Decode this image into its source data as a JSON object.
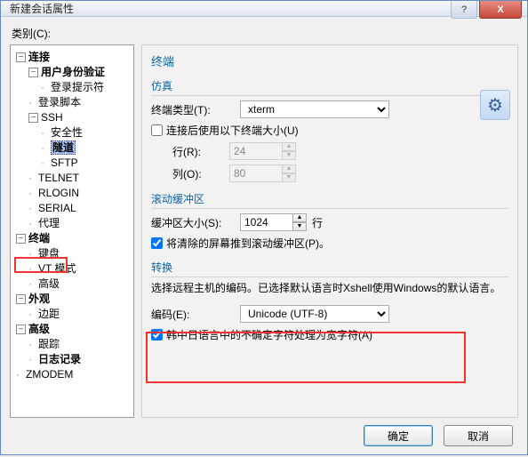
{
  "window": {
    "title": "新建会话属性"
  },
  "titlebar_icons": {
    "help": "?",
    "close": "X"
  },
  "category_label": "类别(C):",
  "tree": {
    "connection": "连接",
    "auth": "用户身份验证",
    "login_prompt": "登录提示符",
    "login_script": "登录脚本",
    "ssh": "SSH",
    "security": "安全性",
    "tunnel": "隧道",
    "sftp": "SFTP",
    "telnet": "TELNET",
    "rlogin": "RLOGIN",
    "serial": "SERIAL",
    "proxy": "代理",
    "terminal": "终端",
    "keyboard": "键盘",
    "vt": "VT 模式",
    "advanced_t": "高级",
    "appearance": "外观",
    "margin": "边距",
    "advanced": "高级",
    "trace": "跟踪",
    "log": "日志记录",
    "zmodem": "ZMODEM"
  },
  "content": {
    "section": "终端",
    "emulation": {
      "title": "仿真",
      "type_label": "终端类型(T):",
      "type_value": "xterm",
      "use_size_label": "连接后使用以下终端大小(U)",
      "use_size_checked": false,
      "rows_label": "行(R):",
      "rows_value": "24",
      "cols_label": "列(O):",
      "cols_value": "80"
    },
    "scrollback": {
      "title": "滚动缓冲区",
      "size_label": "缓冲区大小(S):",
      "size_value": "1024",
      "unit": "行",
      "clear_label": "将清除的屏幕推到滚动缓冲区(P)。",
      "clear_checked": true
    },
    "conversion": {
      "title": "转换",
      "desc": "选择远程主机的编码。已选择默认语言时Xshell使用Windows的默认语言。",
      "encoding_label": "编码(E):",
      "encoding_value": "Unicode (UTF-8)",
      "cjk_label": "韩中日语言中的不确定字符处理为宽字符(A)",
      "cjk_checked": true
    }
  },
  "buttons": {
    "ok": "确定",
    "cancel": "取消"
  },
  "icons": {
    "gear": "⚙",
    "expand": "−",
    "expand_plus": "+"
  }
}
